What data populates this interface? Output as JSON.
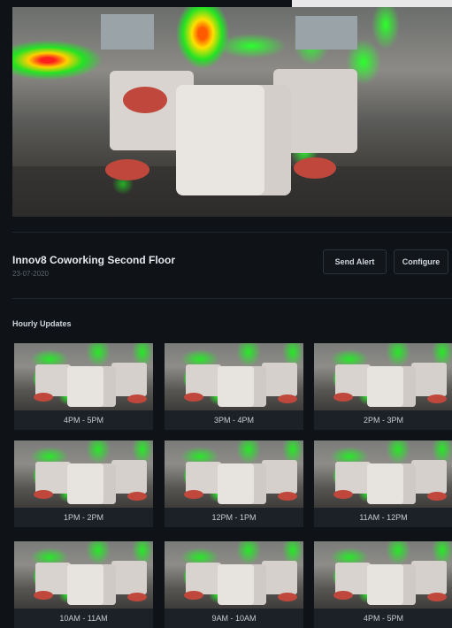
{
  "location": {
    "title": "Innov8 Coworking Second Floor",
    "date": "23-07-2020"
  },
  "actions": {
    "send_alert": "Send Alert",
    "configure": "Configure"
  },
  "hourly": {
    "heading": "Hourly Updates",
    "items": [
      {
        "label": "4PM - 5PM"
      },
      {
        "label": "3PM - 4PM"
      },
      {
        "label": "2PM - 3PM"
      },
      {
        "label": "1PM - 2PM"
      },
      {
        "label": "12PM - 1PM"
      },
      {
        "label": "11AM - 12PM"
      },
      {
        "label": "10AM - 11AM"
      },
      {
        "label": "9AM - 10AM"
      },
      {
        "label": "4PM - 5PM"
      }
    ]
  },
  "colors": {
    "background": "#0f1216",
    "button_border": "#2b323a",
    "heat_high": "#ff1e1e",
    "heat_mid": "#ffd000",
    "heat_low": "#23e323"
  }
}
